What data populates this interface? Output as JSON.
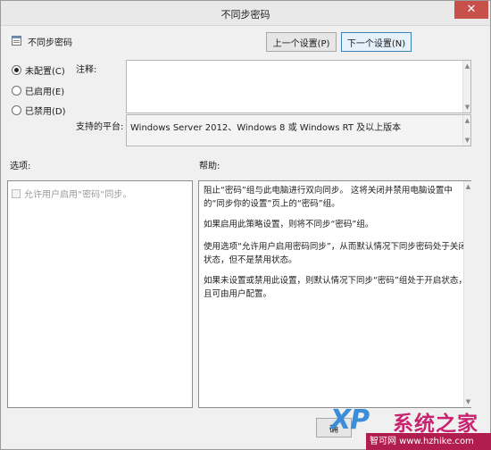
{
  "window": {
    "title": "不同步密码",
    "close_glyph": "✕"
  },
  "header": {
    "policy_name": "不同步密码",
    "prev_button": "上一个设置(P)",
    "next_button": "下一个设置(N)"
  },
  "state_options": [
    {
      "label": "未配置(C)",
      "checked": true
    },
    {
      "label": "已启用(E)",
      "checked": false
    },
    {
      "label": "已禁用(D)",
      "checked": false
    }
  ],
  "comment": {
    "label": "注释:",
    "value": ""
  },
  "platform": {
    "label": "支持的平台:",
    "value": "Windows Server 2012、Windows 8 或 Windows RT 及以上版本"
  },
  "options": {
    "label": "选项:",
    "checkbox_label": "允许用户启用“密码”同步。",
    "checkbox_checked": false,
    "checkbox_enabled": false
  },
  "help": {
    "label": "帮助:",
    "paragraphs": [
      "阻止“密码”组与此电脑进行双向同步。 这将关闭并禁用电脑设置中的“同步你的设置”页上的“密码”组。",
      "如果启用此策略设置，则将不同步“密码”组。",
      "使用选项“允许用户启用密码同步”，从而默认情况下同步密码处于关闭状态，但不是禁用状态。",
      "如果未设置或禁用此设置，则默认情况下同步“密码”组处于开启状态，且可由用户配置。"
    ]
  },
  "footer": {
    "ok_button": "确"
  },
  "watermark": {
    "logo": "XP",
    "title": "系统之家",
    "url": "智可网 www.hzhike.com"
  },
  "icons": {
    "policy": "policy-setting-icon",
    "close": "close-icon",
    "scroll_up": "scroll-up-arrow-icon",
    "scroll_down": "scroll-down-arrow-icon"
  },
  "colors": {
    "close_button": "#c7504a",
    "focus_border": "#3c7fb1",
    "watermark_pink": "#c8246f",
    "watermark_blue": "#3c8ed8"
  }
}
